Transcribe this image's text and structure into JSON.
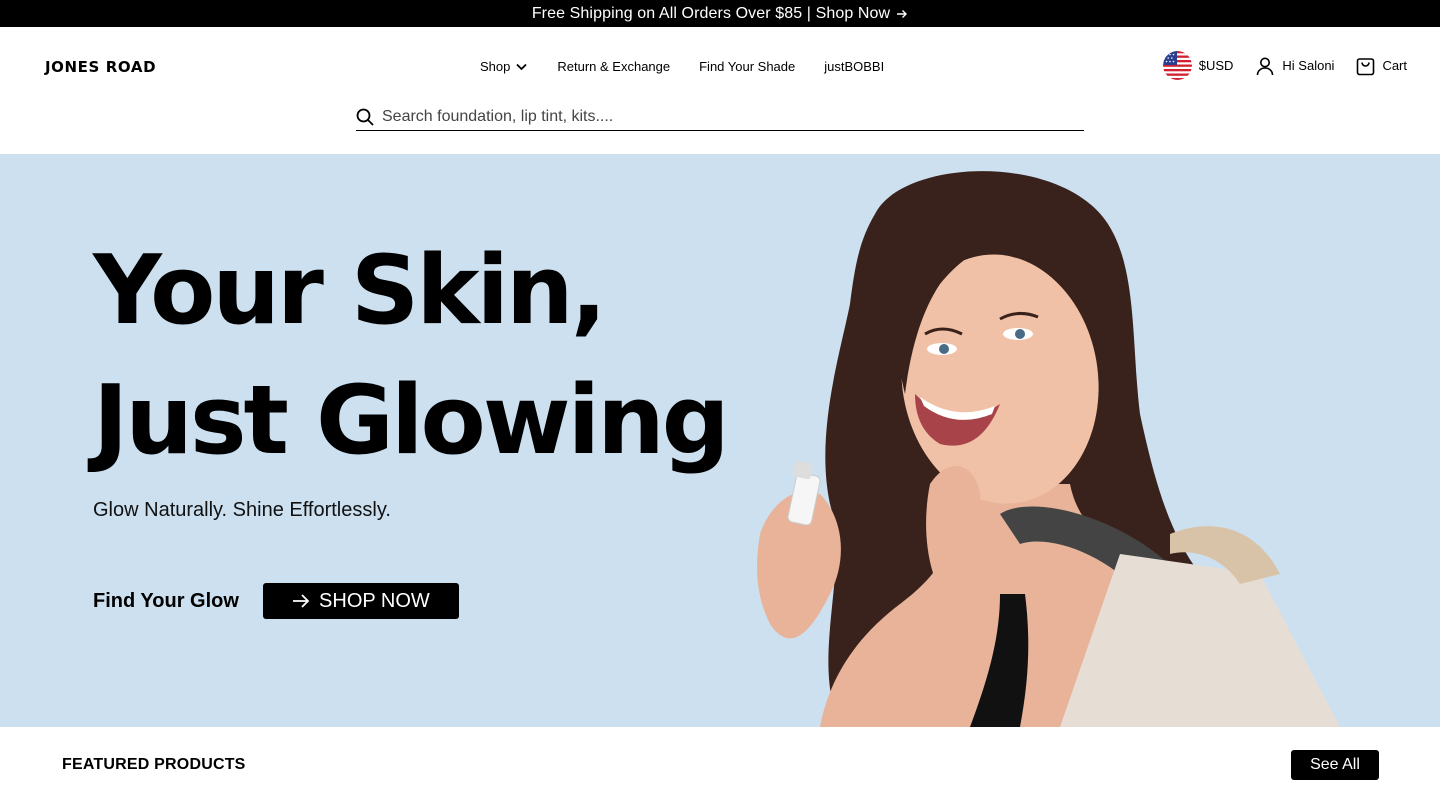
{
  "announcement": {
    "text": "Free Shipping on All Orders Over $85 | Shop Now",
    "icon": "arrow-right-icon"
  },
  "header": {
    "logo": "JONES ROAD",
    "nav": [
      {
        "label": "Shop",
        "has_dropdown": true
      },
      {
        "label": "Return & Exchange"
      },
      {
        "label": "Find Your Shade"
      },
      {
        "label": "justBOBBI"
      }
    ],
    "currency": "$USD",
    "account": "Hi Saloni",
    "cart": "Cart"
  },
  "search": {
    "placeholder": "Search foundation, lip tint, kits...."
  },
  "hero": {
    "title_line1": "Your Skin,",
    "title_line2": "Just Glowing",
    "subtitle": "Glow Naturally. Shine Effortlessly.",
    "cta_label": "Find Your Glow",
    "button": "SHOP NOW",
    "background": "#cce0f0"
  },
  "featured": {
    "title": "FEATURED PRODUCTS",
    "see_all": "See All"
  }
}
